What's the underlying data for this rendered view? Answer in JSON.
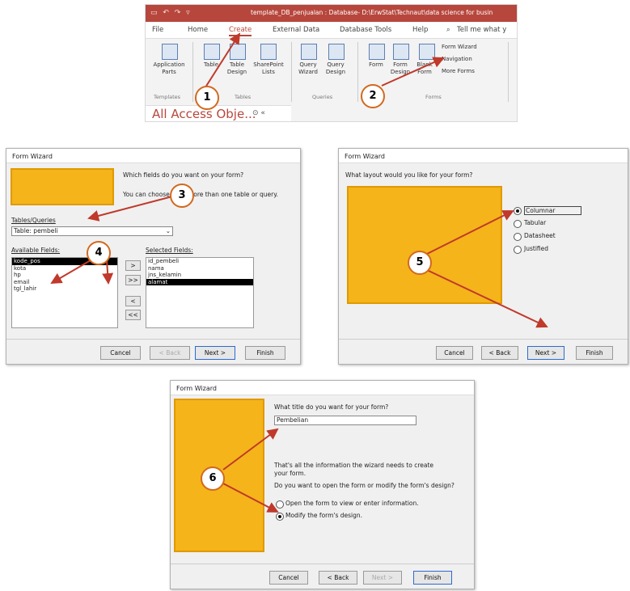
{
  "ribbon": {
    "title": "template_DB_penjualan : Database- D:\\ErwStat\\Technaut\\data science for busin",
    "tabs": [
      "File",
      "Home",
      "Create",
      "External Data",
      "Database Tools",
      "Help"
    ],
    "tell_me": "Tell me what y",
    "buttons": {
      "app_parts": "Application\nParts",
      "table": "Table",
      "table_design": "Table\nDesign",
      "sharepoint": "SharePoint\nLists",
      "query_wizard": "Query\nWizard",
      "query_design": "Query\nDesign",
      "form": "Form",
      "form_design": "Form\nDesign",
      "blank_form": "Blank\nForm",
      "form_wizard": "Form Wizard",
      "navigation": "Navigation",
      "more_forms": "More Forms"
    },
    "groups": [
      "Templates",
      "Tables",
      "Queries",
      "Forms"
    ],
    "nav_pane_title": "All Access Obje...",
    "search_placeholder": "Search..."
  },
  "callouts": [
    "1",
    "2",
    "3",
    "4",
    "5",
    "6"
  ],
  "dialog1": {
    "title": "Form Wizard",
    "question": "Which fields do you want on your form?",
    "hint": "You can choose from more than one table or query.",
    "tables_label": "Tables/Queries",
    "table_value": "Table: pembeli",
    "available_label": "Available Fields:",
    "available": [
      "kode_pos",
      "kota",
      "hp",
      "email",
      "tgl_lahir"
    ],
    "selected_label": "Selected Fields:",
    "selected": [
      "id_pembeli",
      "nama",
      "jns_kelamin",
      "alamat"
    ],
    "move_buttons": [
      ">",
      ">>",
      "<",
      "<<"
    ],
    "cancel": "Cancel",
    "back": "< Back",
    "next": "Next >",
    "finish": "Finish"
  },
  "dialog2": {
    "title": "Form Wizard",
    "question": "What layout would you like for your form?",
    "options": [
      "Columnar",
      "Tabular",
      "Datasheet",
      "Justified"
    ],
    "selected_option": "Columnar",
    "cancel": "Cancel",
    "back": "< Back",
    "next": "Next >",
    "finish": "Finish"
  },
  "dialog3": {
    "title": "Form Wizard",
    "question": "What title do you want for your form?",
    "form_title_value": "Pembelian",
    "info": "That's all the information the wizard needs to create your form.",
    "open_question": "Do you want to open the form or modify the form's design?",
    "options": [
      "Open the form to view or enter information.",
      "Modify the form's design."
    ],
    "selected_option": "Modify the form's design.",
    "cancel": "Cancel",
    "back": "< Back",
    "next": "Next >",
    "finish": "Finish"
  },
  "colors": {
    "access_red": "#b7473d",
    "wizard_yellow": "#f4b41a",
    "callout_border": "#d2691e",
    "arrow": "#c0392b"
  }
}
